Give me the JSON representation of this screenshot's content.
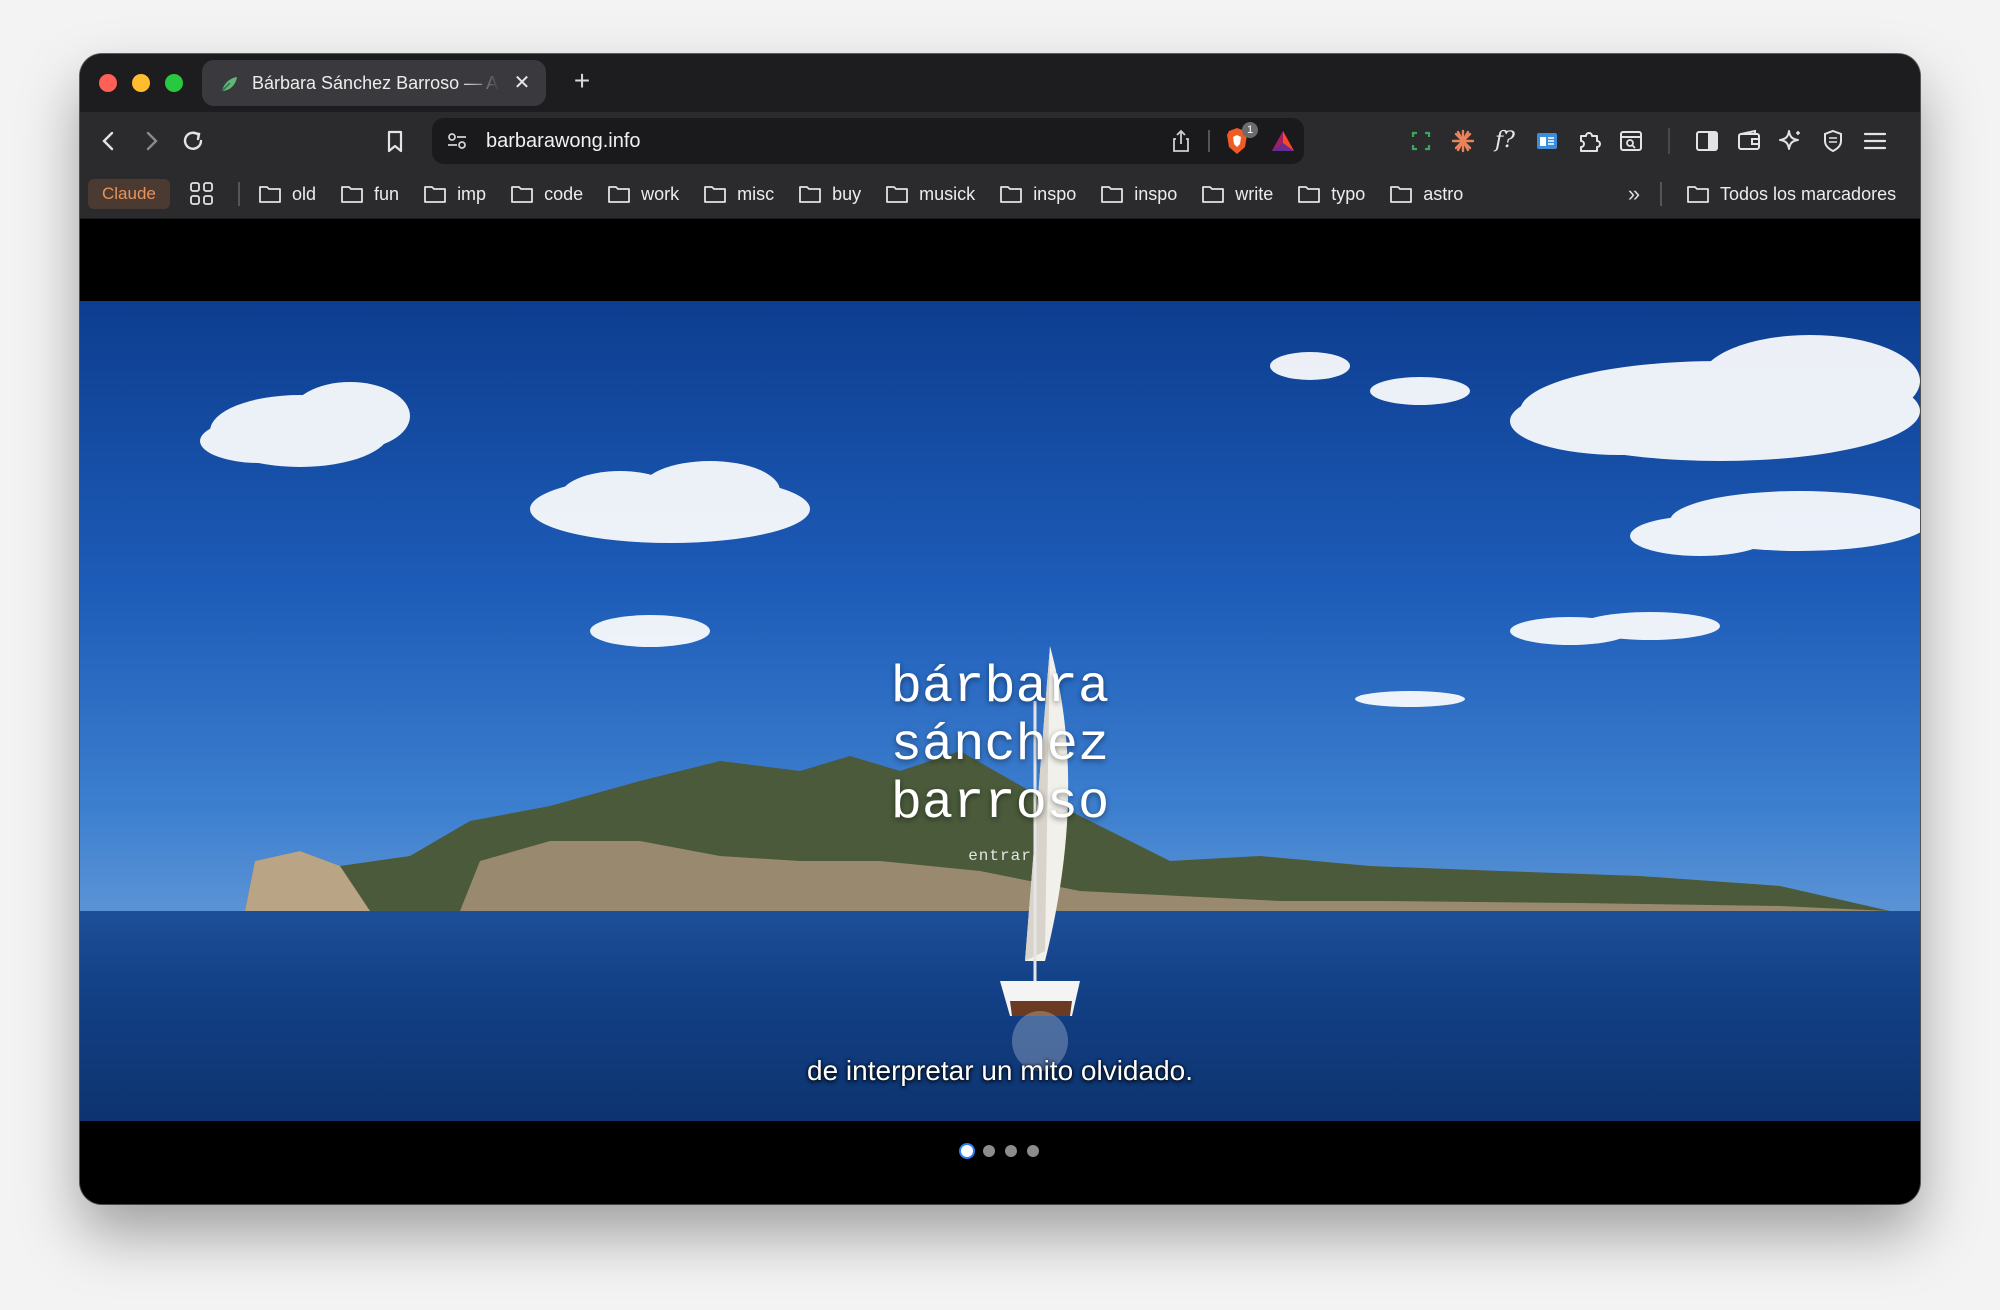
{
  "browser": {
    "tab": {
      "title": "Bárbara Sánchez Barroso — Arquitecta"
    },
    "url": "barbarawong.info",
    "shield_count": "1",
    "bookmarks": {
      "claude": "Claude",
      "folders": [
        "old",
        "fun",
        "imp",
        "code",
        "work",
        "misc",
        "buy",
        "musick",
        "inspo",
        "inspo",
        "write",
        "typo",
        "astro"
      ],
      "all": "Todos los marcadores"
    }
  },
  "page": {
    "title_lines": [
      "bárbara",
      "sánchez",
      "barroso"
    ],
    "enter_label": "entrar",
    "subtitle": "de interpretar un mito olvidado.",
    "slides": {
      "count": 4,
      "active": 0
    }
  },
  "colors": {
    "sky": "#1d5cb8",
    "sea": "#123f85",
    "accent": "#2f7df6"
  }
}
